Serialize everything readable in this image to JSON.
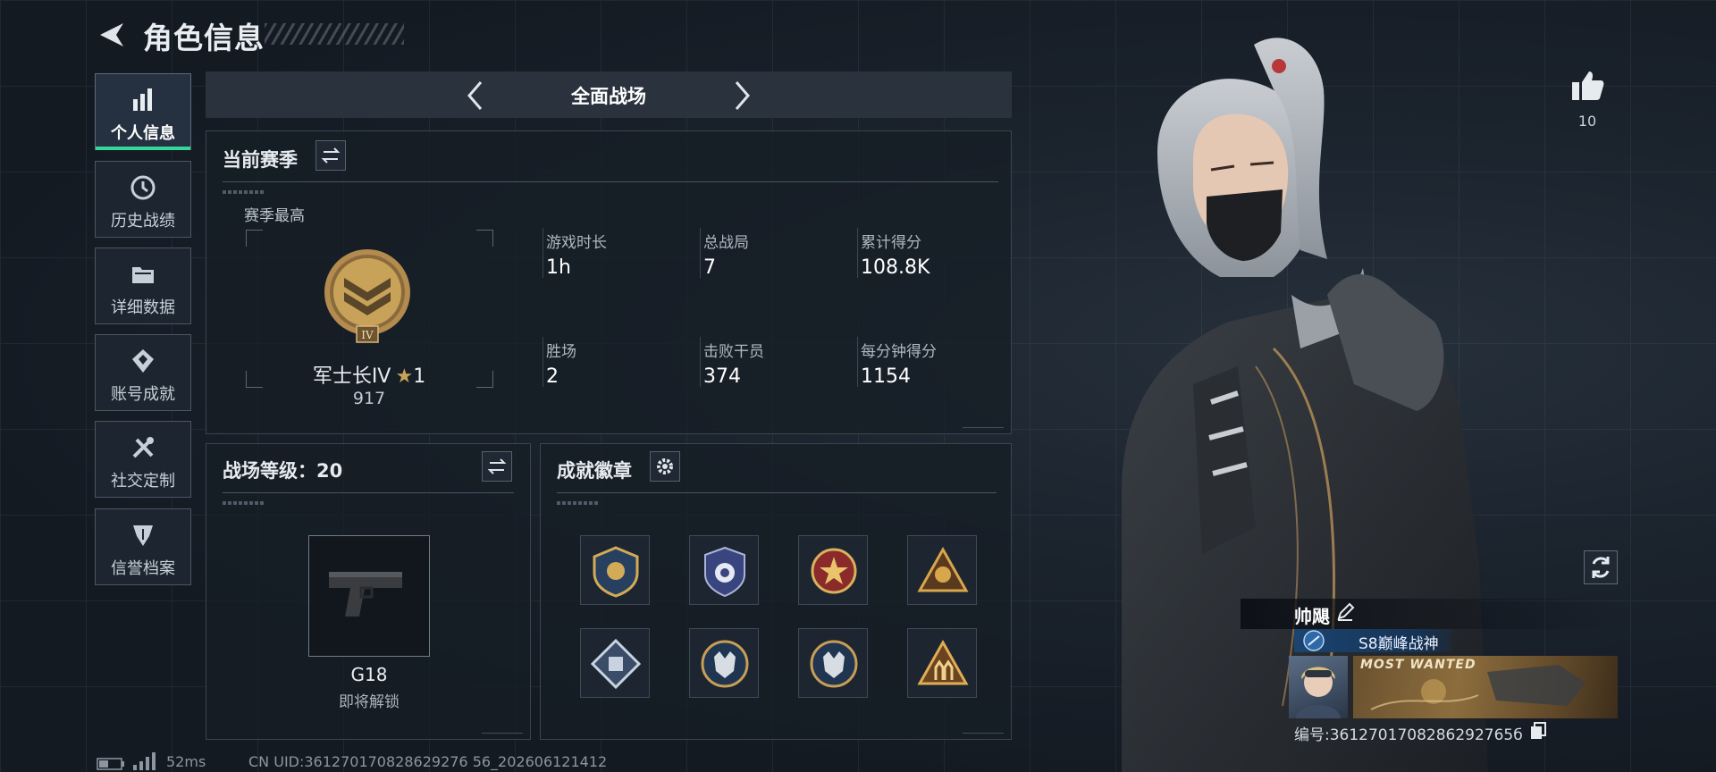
{
  "header": {
    "title": "角色信息"
  },
  "sidebar": {
    "items": [
      {
        "label": "个人信息",
        "icon": "bar-chart-icon",
        "active": true
      },
      {
        "label": "历史战绩",
        "icon": "history-icon",
        "active": false
      },
      {
        "label": "详细数据",
        "icon": "folder-icon",
        "active": false
      },
      {
        "label": "账号成就",
        "icon": "achievement-icon",
        "active": false
      },
      {
        "label": "社交定制",
        "icon": "tools-icon",
        "active": false
      },
      {
        "label": "信誉档案",
        "icon": "credit-shield-icon",
        "active": false
      }
    ]
  },
  "mode": {
    "title": "全面战场"
  },
  "season": {
    "title": "当前赛季",
    "highest_label": "赛季最高",
    "rank_name": "军士长IV",
    "star_count": "1",
    "rank_score": "917",
    "rank_numeral": "IV",
    "stats": [
      {
        "label": "游戏时长",
        "value": "1h"
      },
      {
        "label": "总战局",
        "value": "7"
      },
      {
        "label": "累计得分",
        "value": "108.8K"
      },
      {
        "label": "胜场",
        "value": "2"
      },
      {
        "label": "击败干员",
        "value": "374"
      },
      {
        "label": "每分钟得分",
        "value": "1154"
      }
    ]
  },
  "level": {
    "title": "战场等级：20",
    "weapon_name": "G18",
    "weapon_status": "即将解锁"
  },
  "badges": {
    "title": "成就徽章",
    "items": [
      "badge-1",
      "badge-2",
      "badge-3",
      "badge-4",
      "badge-5",
      "badge-6",
      "badge-7",
      "badge-8"
    ]
  },
  "player": {
    "likes": "10",
    "name": "帅飓",
    "title_badge": "S8巅峰战神",
    "banner_text": "MOST WANTED",
    "id_text": "编号:3612701708286292765б"
  },
  "footer": {
    "ping": "52ms",
    "uid": "CN UID:361270170828629276 56_202606121412"
  },
  "colors": {
    "accent": "#36d59a",
    "panel_border": "#3a4551",
    "gold": "#c9a25a"
  }
}
